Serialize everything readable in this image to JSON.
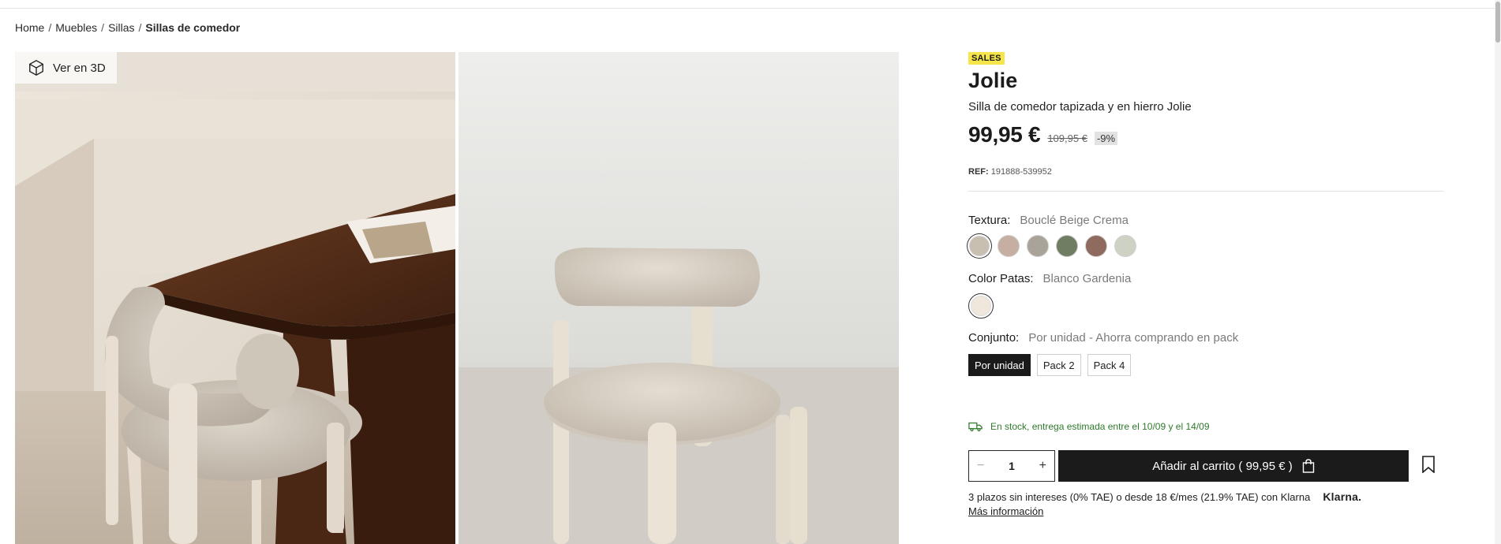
{
  "breadcrumb": {
    "items": [
      "Home",
      "Muebles",
      "Sillas"
    ],
    "separator": "/",
    "current": "Sillas de comedor"
  },
  "gallery": {
    "view_3d_label": "Ver en 3D",
    "view_3d_icon": "cube-icon"
  },
  "product": {
    "badge": "SALES",
    "title": "Jolie",
    "subtitle": "Silla de comedor tapizada y en hierro Jolie",
    "price": "99,95 €",
    "old_price": "109,95 €",
    "discount": "-9%",
    "ref_label": "REF:",
    "ref_value": "191888-539952"
  },
  "options": {
    "texture": {
      "label": "Textura:",
      "value": "Bouclé Beige Crema",
      "swatches": [
        "#c8bfb1",
        "#c7aea2",
        "#aaa39a",
        "#6f7d62",
        "#8e6a5f",
        "#cdd2c5"
      ],
      "selected_index": 0
    },
    "legs": {
      "label": "Color Patas:",
      "value": "Blanco Gardenia",
      "color": "#efe7dc"
    },
    "set": {
      "label": "Conjunto:",
      "value": "Por unidad - Ahorra comprando en pack",
      "packs": [
        "Por unidad",
        "Pack 2",
        "Pack 4"
      ],
      "active_index": 0
    }
  },
  "stock": {
    "text": "En stock, entrega estimada entre el 10/09 y el 14/09",
    "icon": "truck-icon",
    "color": "#2f7a2b"
  },
  "cart": {
    "minus": "−",
    "plus": "+",
    "quantity": "1",
    "add_label": "Añadir al carrito ( 99,95 € )",
    "cart_icon": "shopping-bag-icon",
    "wishlist_icon": "bookmark-icon"
  },
  "financing": {
    "text": "3 plazos sin intereses (0% TAE) o desde 18 €/mes (21.9% TAE) con Klarna",
    "logo": "Klarna.",
    "more_info": "Más información"
  },
  "colors": {
    "accent_dark": "#1b1b1b",
    "sales_badge": "#f5e44a"
  }
}
